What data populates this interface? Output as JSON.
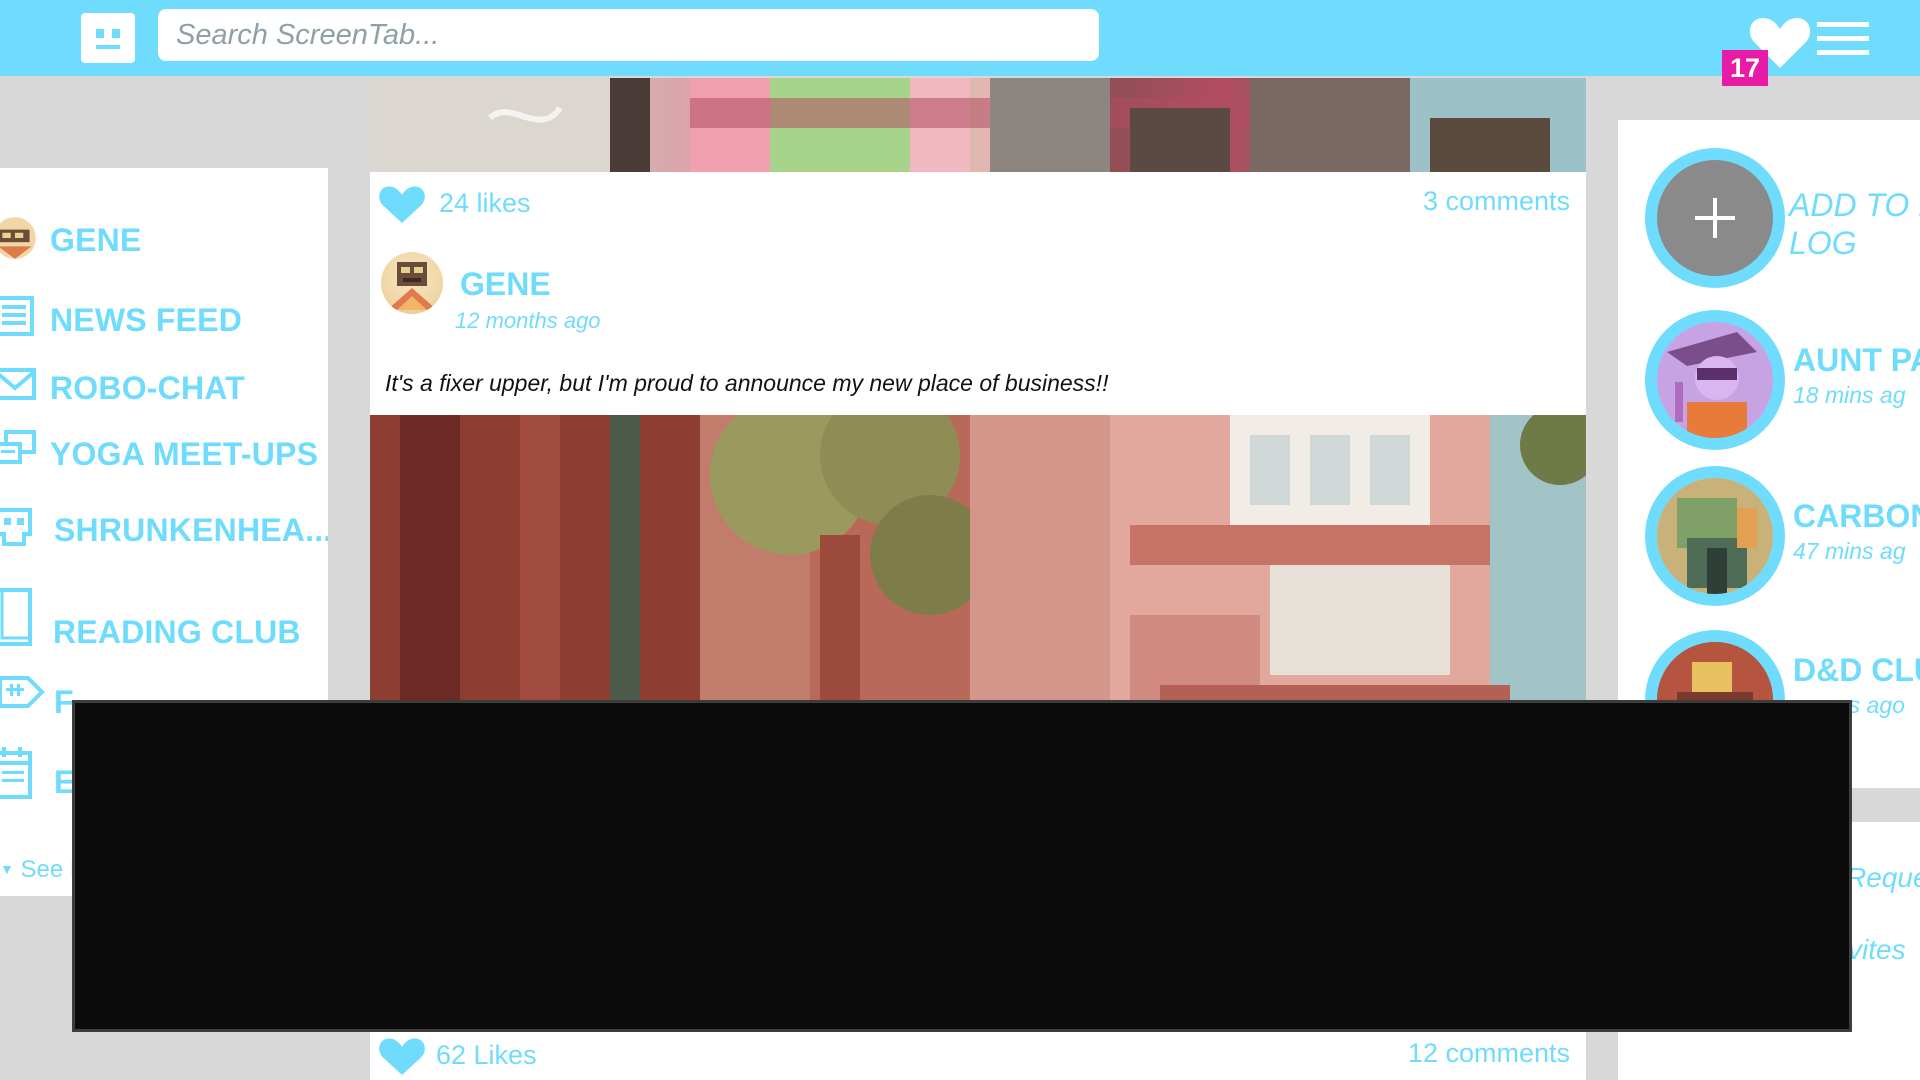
{
  "colors": {
    "accent": "#6fdcfd",
    "badge": "#e81ba6",
    "background": "#d8d8d8",
    "panel": "#ffffff",
    "overlay": "#0b0b0b"
  },
  "header": {
    "logo_icon": "robot-face-icon",
    "search_placeholder": "Search ScreenTab...",
    "notifications_icon": "heart-icon",
    "notification_count": "17",
    "menu_icon": "hamburger-menu-icon"
  },
  "sidebar": {
    "items": [
      {
        "label": "GENE",
        "icon": "avatar-icon"
      },
      {
        "label": "NEWS FEED",
        "icon": "newspaper-icon"
      },
      {
        "label": "ROBO-CHAT",
        "icon": "envelope-icon"
      },
      {
        "label": "YOGA MEET-UPS",
        "icon": "chat-bubbles-icon"
      },
      {
        "label": "SHRUNKENHEA...",
        "icon": "skull-icon"
      },
      {
        "label": "READING CLUB",
        "icon": "book-icon"
      },
      {
        "label": "F",
        "icon": "fish-icon"
      },
      {
        "label": "E",
        "icon": "calendar-icon"
      }
    ],
    "see_more": "See M"
  },
  "feed": {
    "top_post": {
      "likes": "24 likes",
      "comments": "3 comments"
    },
    "post": {
      "author": "GENE",
      "time": "12 months ago",
      "text": "It's a fixer upper, but I'm proud to announce my new place of business!!",
      "likes": "62 Likes",
      "comments": "12 comments"
    }
  },
  "rightcol": {
    "add_button_icon": "plus-icon",
    "add_label_line1": "ADD TO L",
    "add_label_line2": "LOG",
    "friends": [
      {
        "name": "AUNT PA",
        "time": "18 mins ag"
      },
      {
        "name": "CARBON",
        "time": "47 mins ag"
      },
      {
        "name": "D&D CLU",
        "time": "rs ago"
      }
    ],
    "links": [
      "Reque",
      "vites"
    ]
  }
}
